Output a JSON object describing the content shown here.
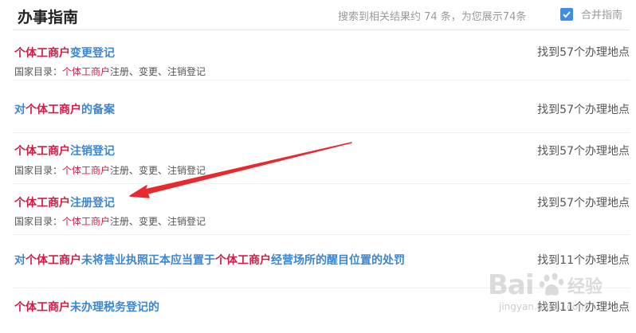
{
  "header": {
    "title": "办事指南",
    "summary": "搜索到相关结果约 74 条，为您展示74条",
    "merge_label": "合并指南",
    "merge_checked": true
  },
  "items": [
    {
      "pre": "",
      "hl": "个体工商户",
      "rest": "变更登记",
      "hl2": "",
      "rest2": "",
      "sub_prefix": "国家目录：",
      "sub_hl": "个体工商户",
      "sub_rest": "注册、变更、注销登记",
      "count": "找到57个办理地点"
    },
    {
      "pre": "对",
      "hl": "个体工商户",
      "rest": "的备案",
      "hl2": "",
      "rest2": "",
      "sub_prefix": "",
      "sub_hl": "",
      "sub_rest": "",
      "count": "找到57个办理地点"
    },
    {
      "pre": "",
      "hl": "个体工商户",
      "rest": "注销登记",
      "hl2": "",
      "rest2": "",
      "sub_prefix": "国家目录：",
      "sub_hl": "个体工商户",
      "sub_rest": "注册、变更、注销登记",
      "count": "找到57个办理地点"
    },
    {
      "pre": "",
      "hl": "个体工商户",
      "rest": "注册登记",
      "hl2": "",
      "rest2": "",
      "sub_prefix": "国家目录：",
      "sub_hl": "个体工商户",
      "sub_rest": "注册、变更、注销登记",
      "count": "找到57个办理地点"
    },
    {
      "pre": "对",
      "hl": "个体工商户",
      "rest": "未将营业执照正本应当置于",
      "hl2": "个体工商户",
      "rest2": "经营场所的醒目位置的处罚",
      "sub_prefix": "",
      "sub_hl": "",
      "sub_rest": "",
      "count": "找到11个办理地点"
    },
    {
      "pre": "",
      "hl": "个体工商户",
      "rest": "未办理税务登记的",
      "hl2": "",
      "rest2": "",
      "sub_prefix": "",
      "sub_hl": "",
      "sub_rest": "",
      "count": "找到11个办理地点"
    }
  ],
  "watermark": {
    "brand": "Bai",
    "cn": "经验",
    "url": "jingyan.baidu.com"
  },
  "colors": {
    "highlight": "#cf1d45",
    "link": "#3b86d1",
    "arrow": "#e8292d",
    "checkbox": "#3e8ee6"
  }
}
